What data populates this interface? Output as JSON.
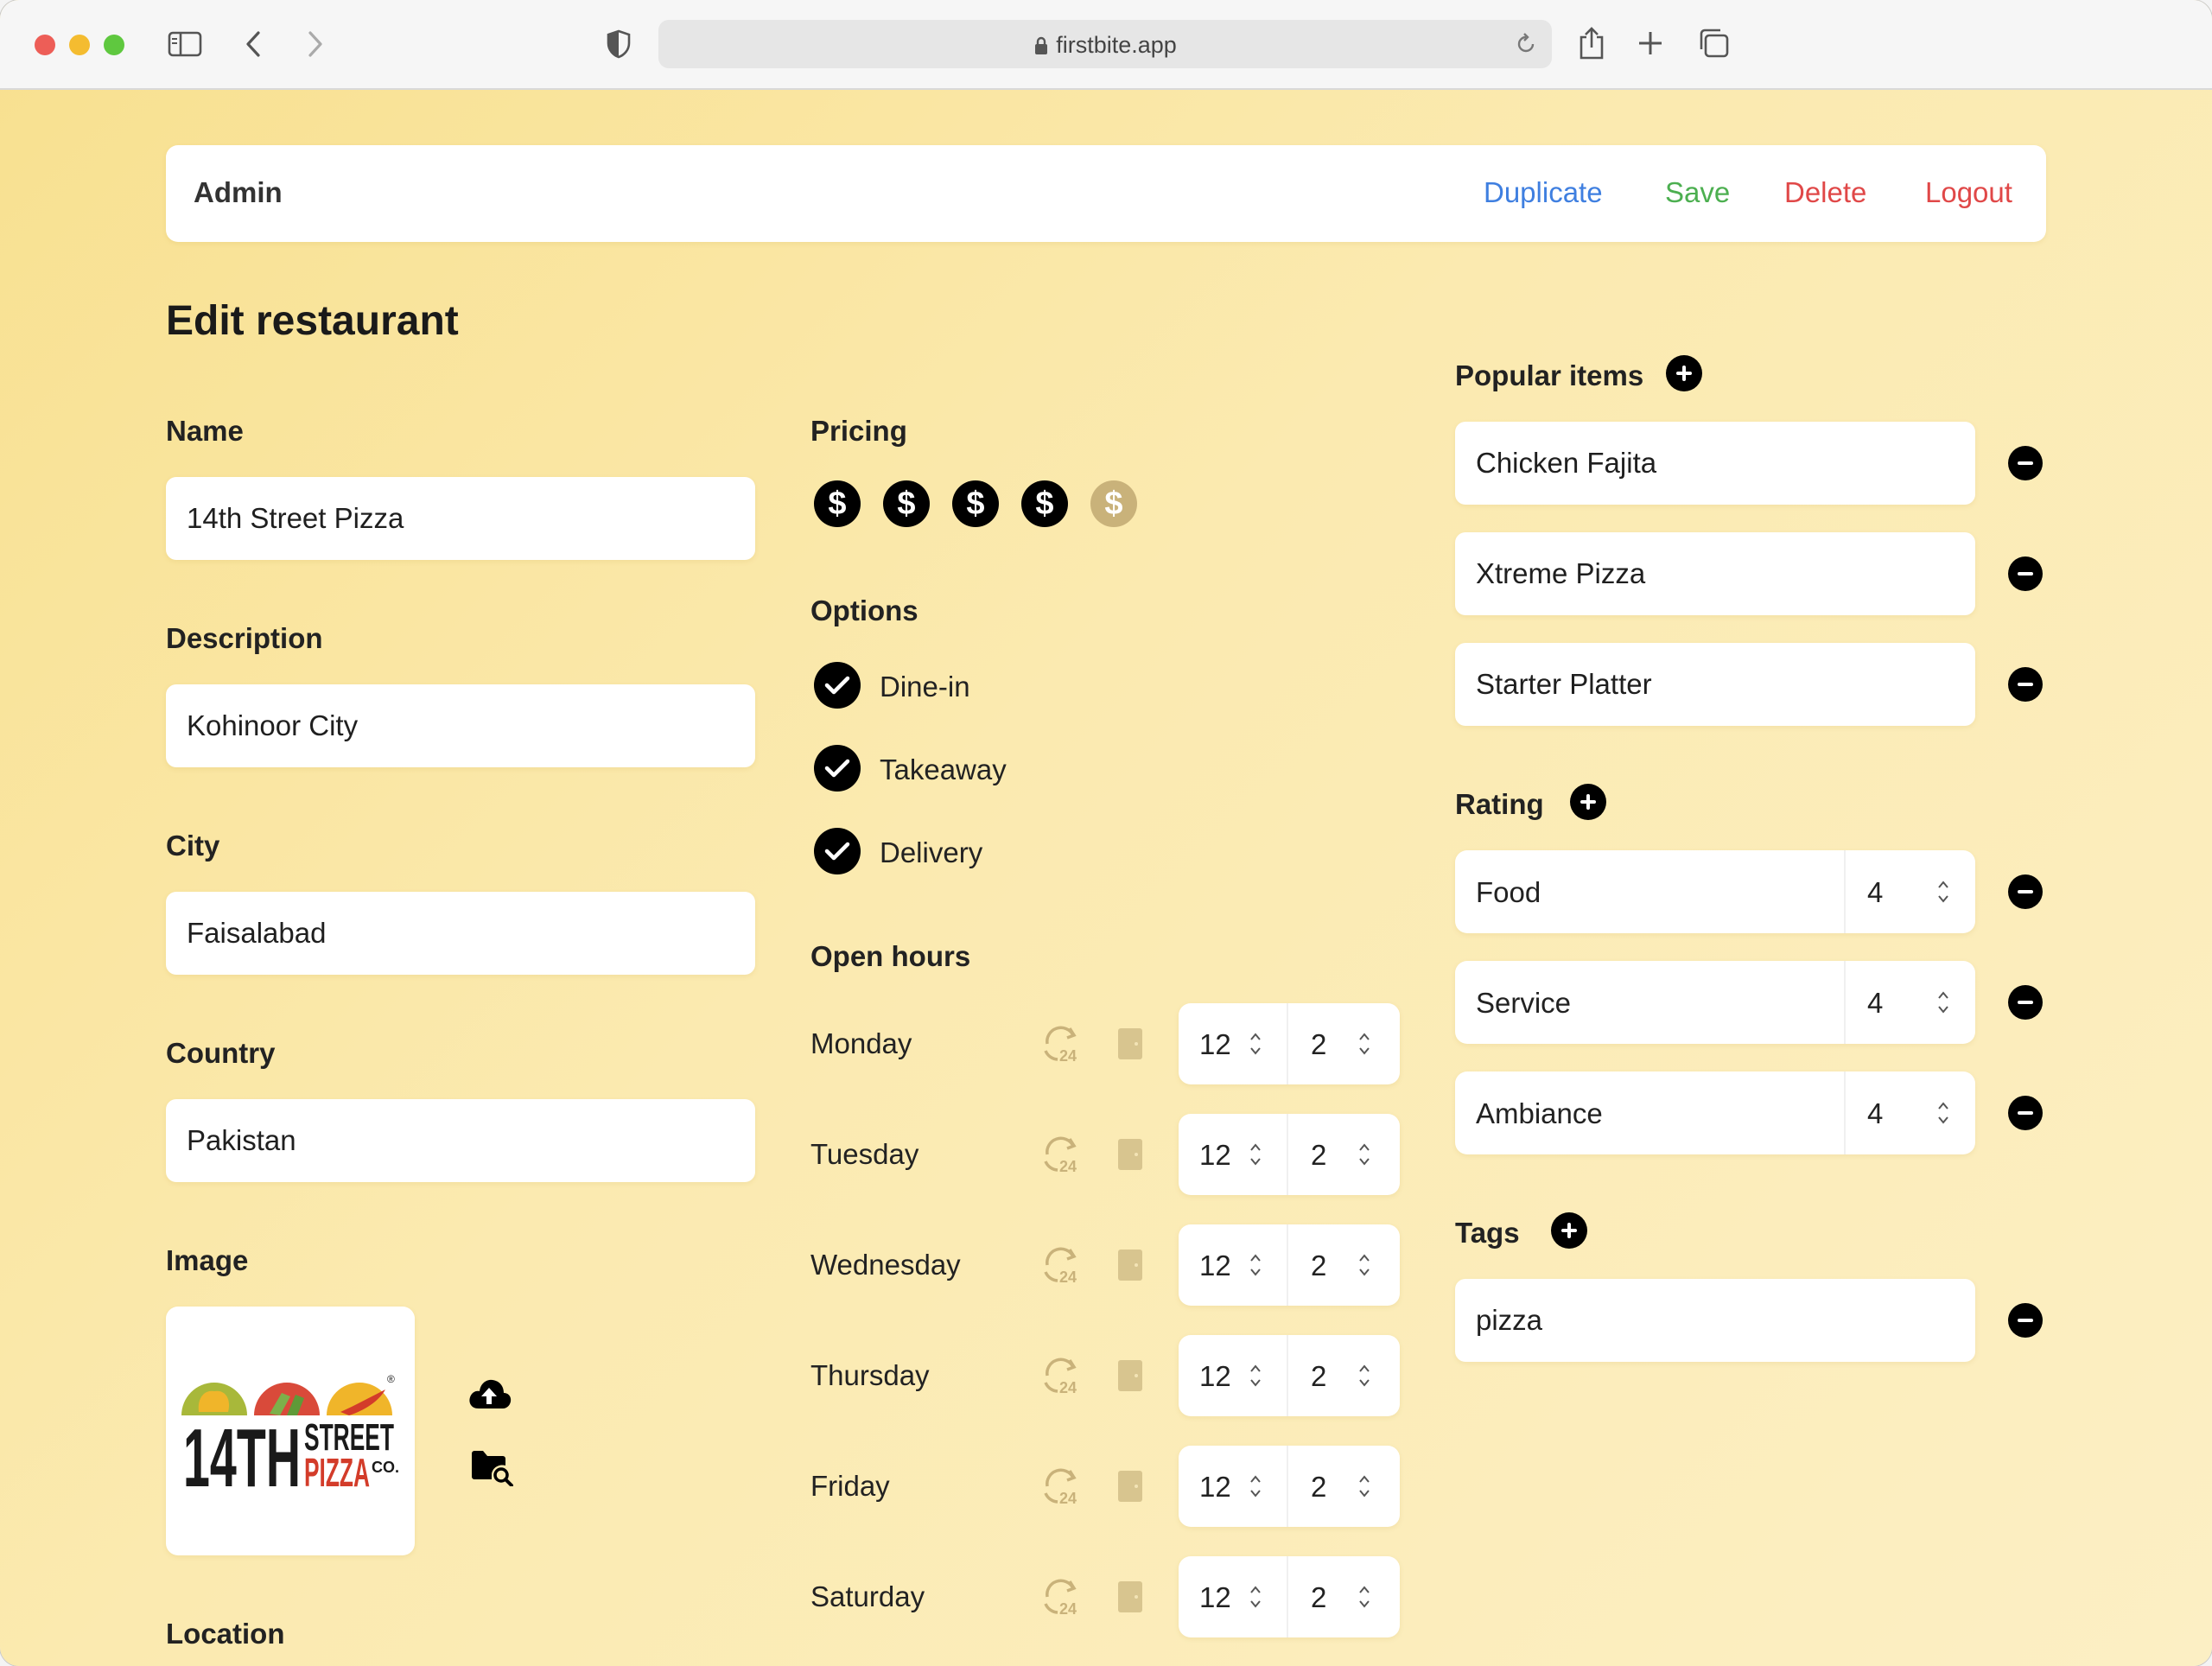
{
  "browser": {
    "url": "firstbite.app"
  },
  "nav": {
    "title": "Admin",
    "duplicate": "Duplicate",
    "save": "Save",
    "delete": "Delete",
    "logout": "Logout"
  },
  "page": {
    "title": "Edit restaurant"
  },
  "form": {
    "name_label": "Name",
    "name_value": "14th Street Pizza",
    "description_label": "Description",
    "description_value": "Kohinoor City",
    "city_label": "City",
    "city_value": "Faisalabad",
    "country_label": "Country",
    "country_value": "Pakistan",
    "image_label": "Image",
    "location_label": "Location"
  },
  "logo": {
    "big": "14TH",
    "street": "STREET",
    "pizza": "PIZZA",
    "co": "CO.",
    "reg": "®"
  },
  "pricing": {
    "label": "Pricing",
    "level": 4,
    "max": 5,
    "symbol": "$"
  },
  "options": {
    "label": "Options",
    "items": [
      {
        "label": "Dine-in",
        "checked": true
      },
      {
        "label": "Takeaway",
        "checked": true
      },
      {
        "label": "Delivery",
        "checked": true
      }
    ]
  },
  "hours": {
    "label": "Open hours",
    "days": [
      {
        "day": "Monday",
        "open": "12",
        "close": "2"
      },
      {
        "day": "Tuesday",
        "open": "12",
        "close": "2"
      },
      {
        "day": "Wednesday",
        "open": "12",
        "close": "2"
      },
      {
        "day": "Thursday",
        "open": "12",
        "close": "2"
      },
      {
        "day": "Friday",
        "open": "12",
        "close": "2"
      },
      {
        "day": "Saturday",
        "open": "12",
        "close": "2"
      }
    ]
  },
  "popular": {
    "label": "Popular items",
    "items": [
      "Chicken Fajita",
      "Xtreme Pizza",
      "Starter Platter"
    ]
  },
  "rating": {
    "label": "Rating",
    "items": [
      {
        "name": "Food",
        "value": "4"
      },
      {
        "name": "Service",
        "value": "4"
      },
      {
        "name": "Ambiance",
        "value": "4"
      }
    ]
  },
  "tags": {
    "label": "Tags",
    "items": [
      "pizza"
    ]
  },
  "colors": {
    "duplicate": "#3f7fe0",
    "save": "#4caf50",
    "delete": "#e04848",
    "logout": "#e04848",
    "check": "#000000",
    "pricing_inactive": "#c9b27a"
  },
  "icons": {
    "upload": "cloud-upload-icon",
    "browse": "folder-search-icon",
    "allday": "24-hour-icon",
    "closed": "door-icon",
    "add": "plus-circle-icon",
    "remove": "minus-circle-icon",
    "checked": "check-circle-icon",
    "price": "dollar-circle-icon"
  }
}
